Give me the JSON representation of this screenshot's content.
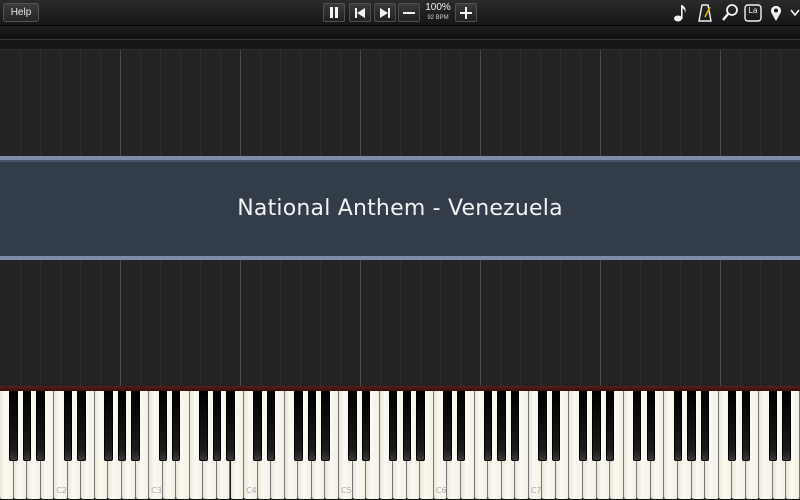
{
  "toolbar": {
    "help_label": "Help",
    "speed": "100%",
    "bpm": "92 BPM",
    "icons": [
      "pause-icon",
      "skip-back-icon",
      "skip-forward-icon",
      "minus-icon",
      "plus-icon",
      "music-note-icon",
      "metronome-icon",
      "magnifier-icon",
      "label-icon",
      "location-pin-icon",
      "chevron-down-icon"
    ],
    "label_icon_text": "La"
  },
  "banner": {
    "title": "National Anthem - Venezuela"
  },
  "keyboard": {
    "octave_labels": [
      "C2",
      "C3",
      "C4",
      "C5",
      "C6",
      "C7"
    ]
  },
  "colors": {
    "banner_bg": "#333c49",
    "banner_border": "#7d8eab",
    "roll_bg": "#232323",
    "keyboard_top": "#5a1c1c"
  }
}
